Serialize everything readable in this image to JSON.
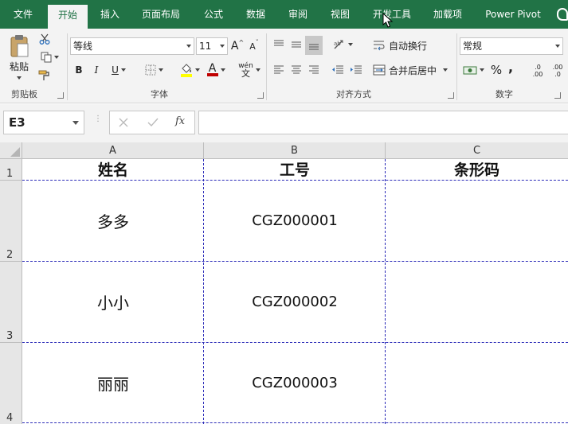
{
  "ribbon_tabs": [
    "文件",
    "开始",
    "插入",
    "页面布局",
    "公式",
    "数据",
    "审阅",
    "视图",
    "开发工具",
    "加载项",
    "Power Pivot"
  ],
  "active_tab": "开始",
  "clipboard": {
    "paste_label": "粘贴",
    "group_label": "剪贴板"
  },
  "font": {
    "font_name": "等线",
    "font_size": "11",
    "bold": "B",
    "italic": "I",
    "underline": "U",
    "grow": "A",
    "shrink": "A",
    "font_color_glyph": "A",
    "phonetic_glyph": "wén",
    "phonetic_sub": "文",
    "group_label": "字体"
  },
  "alignment": {
    "wrap_text": "自动换行",
    "merge_center": "合并后居中",
    "group_label": "对齐方式"
  },
  "number": {
    "format": "常规",
    "percent": "%",
    "comma": ",",
    "inc_decimal_top": ".0",
    "inc_decimal_bottom": ".00",
    "dec_decimal_top": ".00",
    "dec_decimal_bottom": ".0",
    "group_label": "数字"
  },
  "formula_bar": {
    "name_box": "E3",
    "formula_value": "",
    "fx_label": "fx"
  },
  "columns": [
    "A",
    "B",
    "C"
  ],
  "rows": [
    {
      "row": "1",
      "a": "姓名",
      "b": "工号",
      "c": "条形码"
    },
    {
      "row": "2",
      "a": "多多",
      "b": "CGZ000001",
      "c": ""
    },
    {
      "row": "3",
      "a": "小小",
      "b": "CGZ000002",
      "c": ""
    },
    {
      "row": "4",
      "a": "丽丽",
      "b": "CGZ000003",
      "c": ""
    }
  ],
  "colors": {
    "brand_green": "#217346",
    "ribbon_bg": "#f3f3f3",
    "header_bg": "#e6e6e6",
    "page_break": "#2b2bb8"
  }
}
